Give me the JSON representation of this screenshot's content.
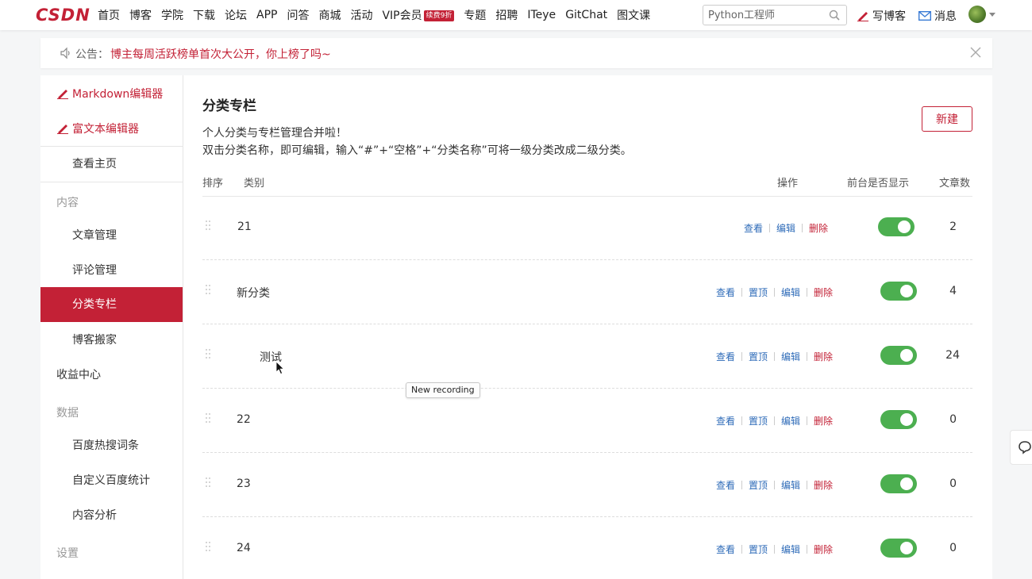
{
  "brand": {
    "logo": "CSDN",
    "accent": "#c32136"
  },
  "nav": {
    "items": [
      "首页",
      "博客",
      "学院",
      "下载",
      "论坛",
      "APP",
      "问答",
      "商城",
      "活动",
      "VIP会员",
      "专题",
      "招聘",
      "ITeye",
      "GitChat",
      "图文课"
    ],
    "vip_badge": "续费9折"
  },
  "search": {
    "placeholder": "Python工程师"
  },
  "header": {
    "write_blog": "写博客",
    "messages": "消息"
  },
  "notice": {
    "label": "公告：",
    "text": "博主每周活跃榜单首次大公开，你上榜了吗~"
  },
  "sidebar": {
    "editors": [
      "Markdown编辑器",
      "富文本编辑器"
    ],
    "home": "查看主页",
    "section_content": "内容",
    "content_items": [
      "文章管理",
      "评论管理",
      "分类专栏",
      "博客搬家"
    ],
    "revenue": "收益中心",
    "section_data": "数据",
    "data_items": [
      "百度热搜词条",
      "自定义百度统计",
      "内容分析"
    ],
    "section_settings": "设置"
  },
  "main": {
    "title": "分类专栏",
    "desc1": "个人分类与专栏管理合并啦！",
    "desc2": "双击分类名称，即可编辑，输入“#”+“空格”+“分类名称”可将一级分类改成二级分类。",
    "new_button": "新建",
    "headers": {
      "order": "排序",
      "category": "类别",
      "actions": "操作",
      "display": "前台是否显示",
      "count": "文章数"
    },
    "action_labels": {
      "view": "查看",
      "pin": "置顶",
      "edit": "编辑",
      "delete": "删除"
    },
    "rows": [
      {
        "name": "21",
        "count": "2",
        "shown": true
      },
      {
        "name": "新分类",
        "count": "4",
        "shown": true
      },
      {
        "name": "测试",
        "count": "24",
        "shown": true
      },
      {
        "name": "22",
        "count": "0",
        "shown": true
      },
      {
        "name": "23",
        "count": "0",
        "shown": true
      },
      {
        "name": "24",
        "count": "0",
        "shown": true
      }
    ]
  },
  "tooltip": "New recording",
  "colors": {
    "toggle_on": "#4caf50",
    "link": "#2e6bb8",
    "delete": "#c32136"
  }
}
